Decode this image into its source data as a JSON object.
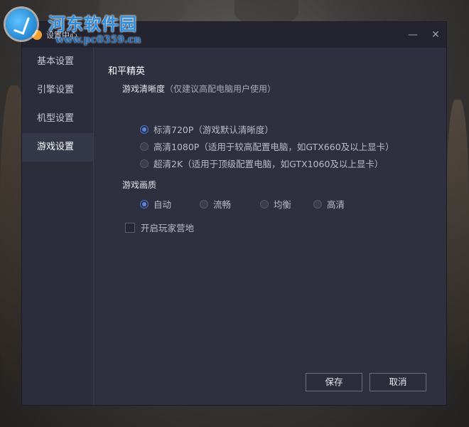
{
  "watermark": {
    "site_name": "河东软件园",
    "url": "www.pc0359.cn"
  },
  "window": {
    "title": "设置中心",
    "minimize_symbol": "—",
    "close_symbol": "✕"
  },
  "sidebar": {
    "items": [
      {
        "label": "基本设置",
        "active": false
      },
      {
        "label": "引擎设置",
        "active": false
      },
      {
        "label": "机型设置",
        "active": false
      },
      {
        "label": "游戏设置",
        "active": true
      }
    ]
  },
  "content": {
    "section_title": "和平精英",
    "resolution": {
      "label": "游戏清晰度",
      "hint": "（仅建议高配电脑用户使用）",
      "options": [
        {
          "label": "标清720P（游戏默认清晰度）",
          "checked": true
        },
        {
          "label": "高清1080P（适用于较高配置电脑，如GTX660及以上显卡）",
          "checked": false
        },
        {
          "label": "超清2K（适用于顶级配置电脑，如GTX1060及以上显卡）",
          "checked": false
        }
      ]
    },
    "quality": {
      "label": "游戏画质",
      "options": [
        {
          "label": "自动",
          "checked": true
        },
        {
          "label": "流畅",
          "checked": false
        },
        {
          "label": "均衡",
          "checked": false
        },
        {
          "label": "高清",
          "checked": false
        }
      ]
    },
    "player_camp": {
      "label": "开启玩家营地",
      "checked": false
    }
  },
  "footer": {
    "save_label": "保存",
    "cancel_label": "取消"
  },
  "colors": {
    "accent": "#5b86e0",
    "dialog_bg": "#2e303f",
    "titlebar_bg": "#23242f"
  }
}
